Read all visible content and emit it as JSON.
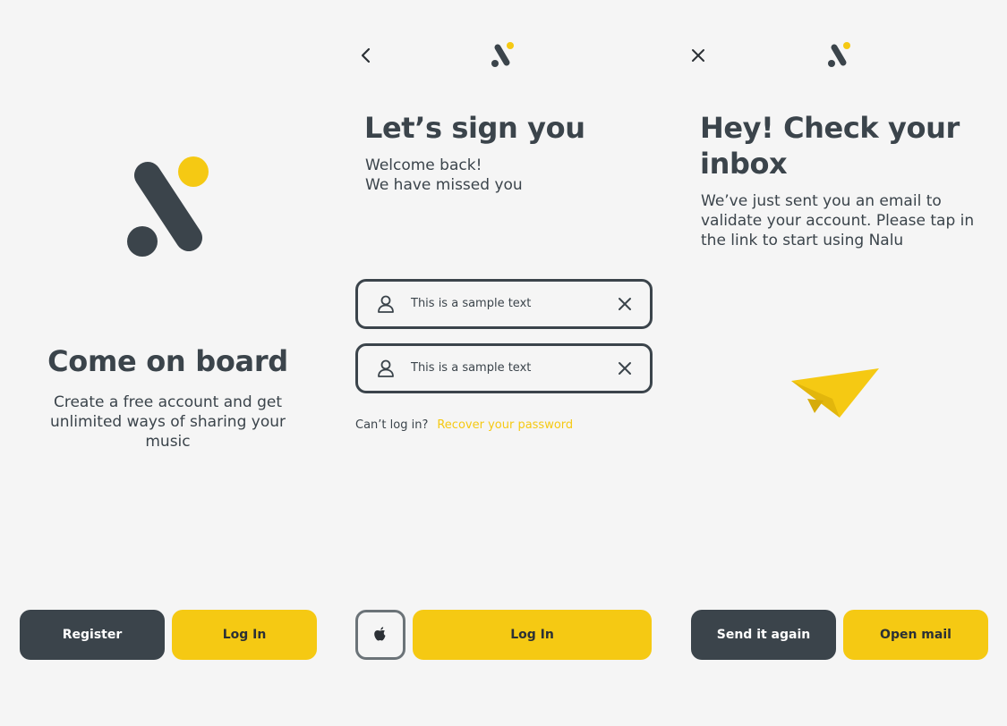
{
  "colors": {
    "background": "#f5f5f5",
    "dark": "#3b444b",
    "accent": "#f5c913"
  },
  "screen1": {
    "logo": "nalu-logo",
    "title": "Come on board",
    "subtitle": "Create a free account and get unlimited ways of sharing your music",
    "register_label": "Register",
    "login_label": "Log In"
  },
  "screen2": {
    "back_icon": "chevron-left-icon",
    "logo": "nalu-logo",
    "title": "Let’s sign you",
    "subtitle_line1": "Welcome back!",
    "subtitle_line2": "We have missed you",
    "fields": [
      {
        "icon": "user-icon",
        "value": "This is a sample text",
        "clear_icon": "close-icon"
      },
      {
        "icon": "user-icon",
        "value": "This is a sample text",
        "clear_icon": "close-icon"
      }
    ],
    "cant_login_text": "Can’t log in?",
    "recover_link": "Recover your password",
    "apple_icon": "apple-icon",
    "login_label": "Log In"
  },
  "screen3": {
    "close_icon": "close-icon",
    "logo": "nalu-logo",
    "title_line1": "Hey! Check your",
    "title_line2": "inbox",
    "message_line1": "We’ve just sent you an email to",
    "message_line2": "validate your account. Please tap in",
    "message_line3": "the link to start using Nalu",
    "illustration": "paper-plane-icon",
    "send_again_label": "Send it again",
    "open_mail_label": "Open mail"
  }
}
